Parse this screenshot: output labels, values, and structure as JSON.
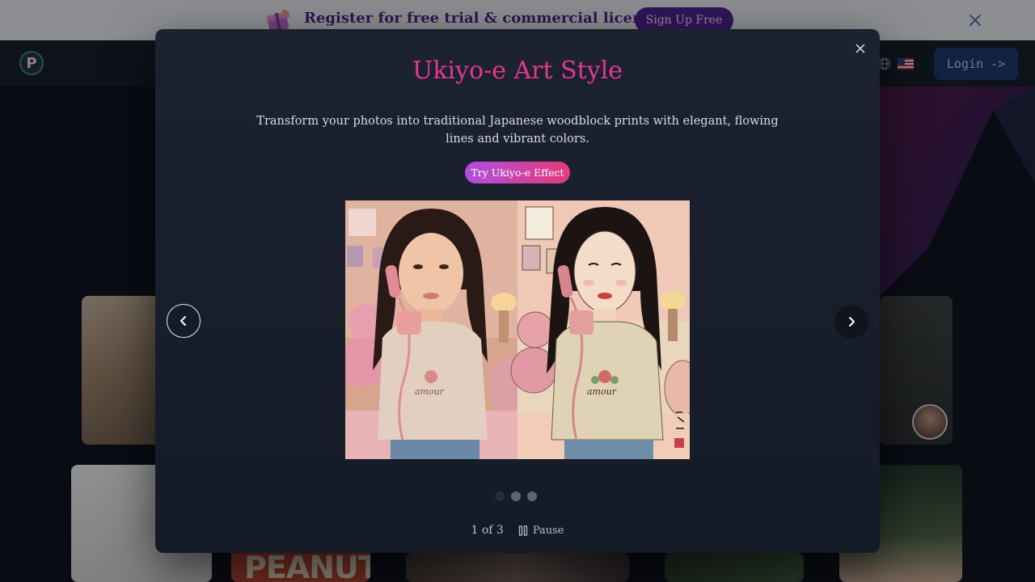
{
  "promo": {
    "text": "Register for free trial & commercial license",
    "cta": "Sign Up Free",
    "icon": "gift-icon",
    "close_icon": "close-icon"
  },
  "nav": {
    "logo": "P",
    "language_icon": "globe-icon",
    "flag_icon": "us-flag-icon",
    "login_label": "Login ->"
  },
  "gallery": {
    "poster_text": "PEANUT"
  },
  "modal": {
    "title": "Ukiyo-e Art Style",
    "description": "Transform your photos into traditional Japanese woodblock prints with elegant, flowing lines and vibrant colors.",
    "cta": "Try Ukiyo-e Effect",
    "image": {
      "before_caption_on_shirt": "amour",
      "after_caption_on_shirt": "amour"
    },
    "carousel": {
      "current": 1,
      "total": 3,
      "counter_text": "1 of 3",
      "pause_label": "Pause",
      "active_dot_index": 0
    }
  },
  "colors": {
    "title_pink": "#e2398f",
    "cta_gradient_start": "#b14ee0",
    "cta_gradient_end": "#e43b78",
    "promo_purple": "#4e1e8e",
    "login_blue": "#1d3566"
  }
}
